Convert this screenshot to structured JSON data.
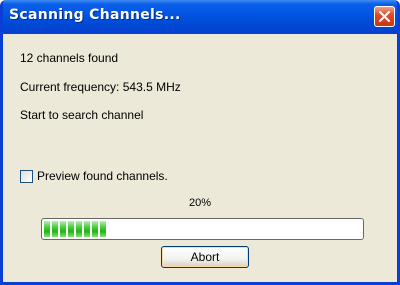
{
  "window": {
    "title": "Scanning Channels...",
    "close_icon": "close-icon"
  },
  "status": {
    "channels_found": "12 channels found",
    "current_frequency": "Current frequency: 543.5 MHz",
    "message": "Start to search channel"
  },
  "preview": {
    "label": "Preview found channels.",
    "checked": false
  },
  "progress": {
    "percent_label": "20%",
    "value": 0.2
  },
  "actions": {
    "abort_label": "Abort"
  },
  "colors": {
    "titlebar": "#0054e3",
    "progress_fill": "#22b214",
    "close_button": "#e1492a"
  }
}
